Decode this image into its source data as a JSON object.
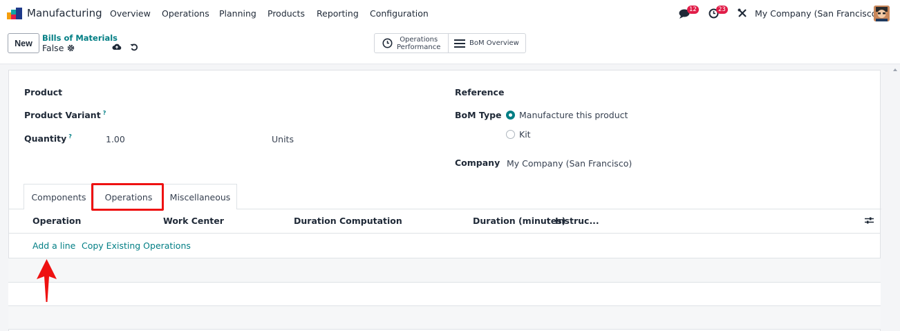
{
  "navbar": {
    "app_name": "Manufacturing",
    "menu": [
      "Overview",
      "Operations",
      "Planning",
      "Products",
      "Reporting",
      "Configuration"
    ],
    "messages_count": "12",
    "activities_count": "23",
    "company": "My Company (San Francisco)"
  },
  "control_panel": {
    "new_label": "New",
    "breadcrumb": "Bills of Materials",
    "record_name": "False",
    "stat_operations_line1": "Operations",
    "stat_operations_line2": "Performance",
    "stat_bom_overview": "BoM Overview"
  },
  "form": {
    "product_label": "Product",
    "product_variant_label": "Product Variant",
    "quantity_label": "Quantity",
    "quantity_value": "1.00",
    "uom_value": "Units",
    "help_mark": "?",
    "reference_label": "Reference",
    "bom_type_label": "BoM Type",
    "bom_type_options": [
      "Manufacture this product",
      "Kit"
    ],
    "bom_type_selected": "Manufacture this product",
    "company_label": "Company",
    "company_value": "My Company (San Francisco)"
  },
  "tabs": {
    "items": [
      "Components",
      "Operations",
      "Miscellaneous"
    ],
    "active": "Operations"
  },
  "operations_table": {
    "columns": [
      "Operation",
      "Work Center",
      "Duration Computation",
      "Duration (minutes)",
      "Instruc..."
    ],
    "add_line": "Add a line",
    "copy_existing": "Copy Existing Operations"
  },
  "colors": {
    "accent": "#017e84",
    "badge": "#e11d48",
    "annotation": "#ee1111"
  }
}
